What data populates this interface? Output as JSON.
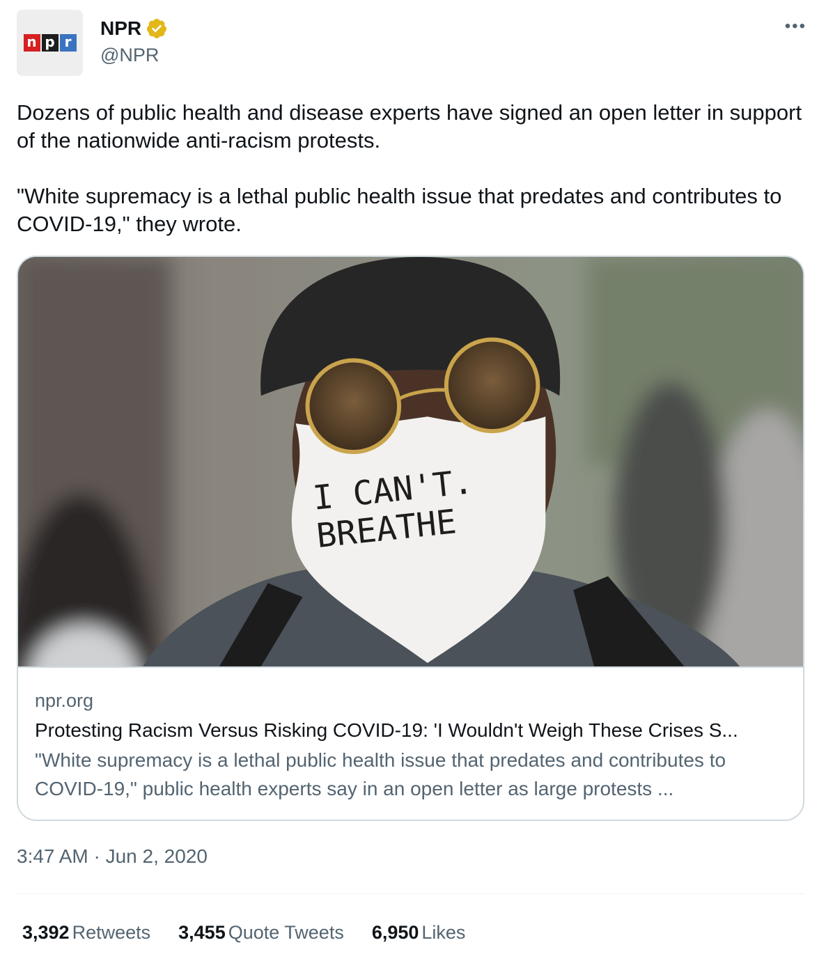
{
  "account": {
    "name": "NPR",
    "handle": "@NPR",
    "logo_letters": [
      "n",
      "p",
      "r"
    ],
    "verified_color": "#e2b719"
  },
  "more_label": "•••",
  "tweet": {
    "paragraph_1": "Dozens of public health and disease experts have signed an open letter in support of the nationwide anti-racism protests.",
    "paragraph_2": "\"White supremacy is a lethal public health issue that predates and contributes to COVID-19,\" they wrote."
  },
  "card": {
    "image_mask_text_1": "I CAN'T.",
    "image_mask_text_2": "BREATHE",
    "domain": "npr.org",
    "title": "Protesting Racism Versus Risking COVID-19: 'I Wouldn't Weigh These Crises S...",
    "description": "\"White supremacy is a lethal public health issue that predates and contributes to COVID-19,\" public health experts say in an open letter as large protests ..."
  },
  "timestamp": "3:47 AM · Jun 2, 2020",
  "stats": {
    "retweets": {
      "count": "3,392",
      "label": "Retweets"
    },
    "quotes": {
      "count": "3,455",
      "label": "Quote Tweets"
    },
    "likes": {
      "count": "6,950",
      "label": "Likes"
    }
  }
}
